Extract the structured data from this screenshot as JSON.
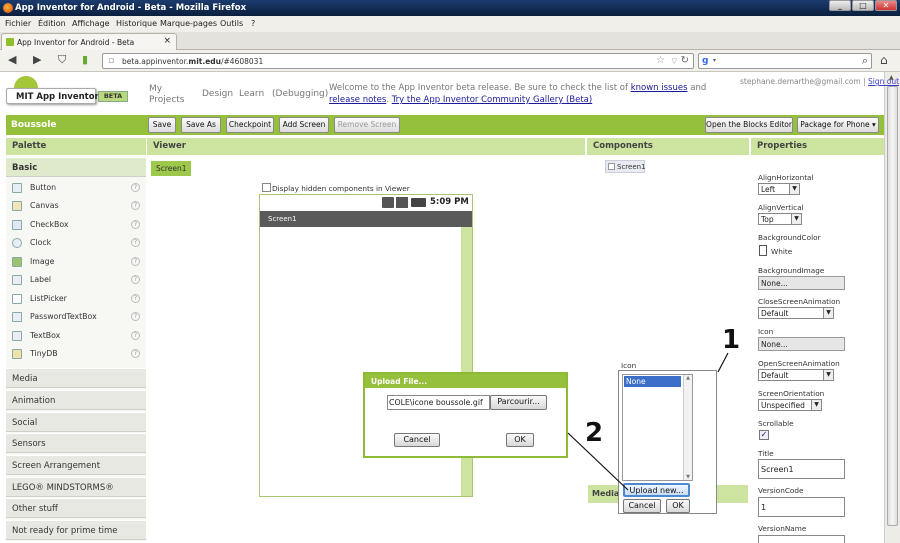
{
  "window": {
    "title": "App Inventor for Android - Beta - Mozilla Firefox",
    "buttons": [
      "_",
      "□",
      "✕"
    ]
  },
  "menu": [
    "Fichier",
    "Édition",
    "Affichage",
    "Historique",
    "Marque-pages",
    "Outils",
    "?"
  ],
  "tab": {
    "label": "App Inventor for Android - Beta",
    "close": "×"
  },
  "nav": {
    "url_prefix": "beta.appinventor.",
    "url_domain": "mit.edu",
    "url_suffix": "/#4608031",
    "search_placeholder": ""
  },
  "header": {
    "logo_text": "MIT App Inventor",
    "logo_badge": "BETA",
    "links": [
      "My Projects",
      "Design",
      "Learn",
      "(Debugging)"
    ],
    "welcome_pre": "Welcome to the App Inventor beta release. Be sure to check the list of ",
    "known_issues": "known issues",
    "and": " and ",
    "release_notes": "release notes",
    "gallery": "Try the App Inventor Community Gallery (Beta)",
    "user_email": "stephane.demarthe@gmail.com",
    "sep": " | ",
    "sign_out": "Sign out"
  },
  "project": {
    "name": "Boussole",
    "buttons": [
      "Save",
      "Save As",
      "Checkpoint",
      "Add Screen",
      "Remove Screen"
    ],
    "blocks_editor": "Open the Blocks Editor",
    "package": "Package for Phone ▾"
  },
  "palette": {
    "title": "Palette",
    "basic": "Basic",
    "items": [
      "Button",
      "Canvas",
      "CheckBox",
      "Clock",
      "Image",
      "Label",
      "ListPicker",
      "PasswordTextBox",
      "TextBox",
      "TinyDB"
    ],
    "categories": [
      "Media",
      "Animation",
      "Social",
      "Sensors",
      "Screen Arrangement",
      "LEGO® MINDSTORMS®",
      "Other stuff",
      "Not ready for prime time"
    ]
  },
  "viewer": {
    "title": "Viewer",
    "screen_tab": "Screen1",
    "hidden_label": "Display hidden components in Viewer",
    "time": "5:09 PM",
    "screen_title": "Screen1"
  },
  "components": {
    "title": "Components",
    "root": "Screen1",
    "media": "Media"
  },
  "properties": {
    "title": "Properties",
    "align_h_label": "AlignHorizontal",
    "align_h": "Left",
    "align_v_label": "AlignVertical",
    "align_v": "Top",
    "bgcolor_label": "BackgroundColor",
    "bgcolor": "White",
    "bgimage_label": "BackgroundImage",
    "bgimage": "None...",
    "close_anim_label": "CloseScreenAnimation",
    "close_anim": "Default",
    "icon_label": "Icon",
    "icon": "None...",
    "open_anim_label": "OpenScreenAnimation",
    "open_anim": "Default",
    "orientation_label": "ScreenOrientation",
    "orientation": "Unspecified",
    "scrollable_label": "Scrollable",
    "title_label": "Title",
    "title_value": "Screen1",
    "version_code_label": "VersionCode",
    "version_code": "1",
    "version_name_label": "VersionName"
  },
  "icon_popup": {
    "label": "Icon",
    "selected": "None",
    "upload": "Upload new...",
    "cancel": "Cancel",
    "ok": "OK"
  },
  "upload_dialog": {
    "title": "Upload File...",
    "path": "COLE\\icone boussole.gif",
    "browse": "Parcourir...",
    "cancel": "Cancel",
    "ok": "OK"
  },
  "annotations": [
    "1",
    "2"
  ],
  "colors": {
    "green": "#95c03c",
    "light_green": "#cde4a0"
  }
}
